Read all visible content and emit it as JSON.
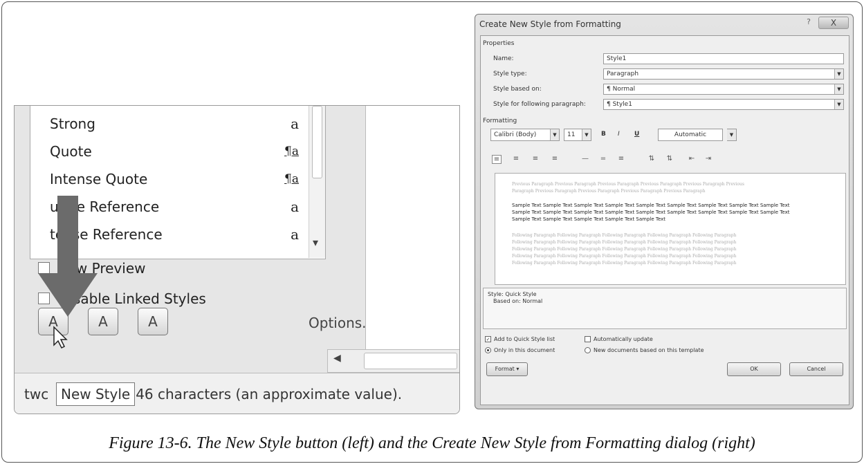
{
  "styles_pane": {
    "items": [
      {
        "name": "Strong",
        "glyph": "a"
      },
      {
        "name": "Quote",
        "glyph": "¶a"
      },
      {
        "name": "Intense Quote",
        "glyph": "¶a"
      },
      {
        "name": "ubtle Reference",
        "glyph": "a"
      },
      {
        "name": "tense Reference",
        "glyph": "a"
      }
    ],
    "show_preview": "how Preview",
    "disable_linked": "Disable Linked Styles",
    "buttons": {
      "new_style": "A",
      "inspector": "A",
      "manage": "A"
    },
    "options": "Options...",
    "tooltip": "New Style",
    "status_text": "twc",
    "status_text_tail": "46 characters (an approximate value)."
  },
  "dialog": {
    "title": "Create New Style from Formatting",
    "help": "?",
    "close": "X",
    "properties_label": "Properties",
    "name_label": "Name:",
    "name_value": "Style1",
    "style_type_label": "Style type:",
    "style_type_value": "Paragraph",
    "based_on_label": "Style based on:",
    "based_on_value": "¶ Normal",
    "following_label": "Style for following paragraph:",
    "following_value": "¶ Style1",
    "formatting_label": "Formatting",
    "font_value": "Calibri (Body)",
    "size_value": "11",
    "bold": "B",
    "italic": "I",
    "underline": "U",
    "color_value": "Automatic",
    "preview_previous": [
      "Previous Paragraph Previous Paragraph Previous Paragraph Previous Paragraph Previous Paragraph Previous",
      "Paragraph Previous Paragraph Previous Paragraph Previous Paragraph Previous Paragraph"
    ],
    "preview_sample": [
      "Sample Text Sample Text Sample Text Sample Text Sample Text Sample Text Sample Text Sample Text Sample Text",
      "Sample Text Sample Text Sample Text Sample Text Sample Text Sample Text Sample Text Sample Text Sample Text",
      "Sample Text Sample Text Sample Text Sample Text Sample Text"
    ],
    "preview_following": [
      "Following Paragraph Following Paragraph Following Paragraph Following Paragraph Following Paragraph",
      "Following Paragraph Following Paragraph Following Paragraph Following Paragraph Following Paragraph",
      "Following Paragraph Following Paragraph Following Paragraph Following Paragraph Following Paragraph",
      "Following Paragraph Following Paragraph Following Paragraph Following Paragraph Following Paragraph",
      "Following Paragraph Following Paragraph Following Paragraph Following Paragraph Following Paragraph"
    ],
    "desc_line1": "Style: Quick Style",
    "desc_line2": "Based on: Normal",
    "add_quick_style": "Add to Quick Style list",
    "auto_update": "Automatically update",
    "only_this_doc": "Only in this document",
    "new_docs": "New documents based on this template",
    "format_button": "Format ▾",
    "ok_button": "OK",
    "cancel_button": "Cancel"
  },
  "caption": "Figure 13-6. The New Style button (left) and the Create New Style from Formatting dialog (right)"
}
